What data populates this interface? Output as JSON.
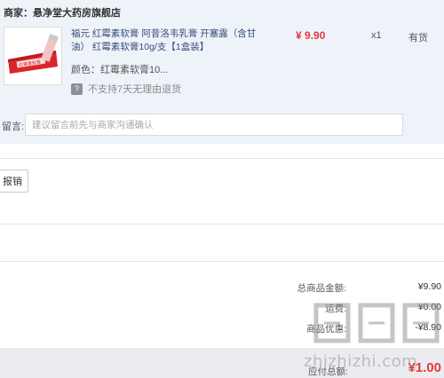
{
  "store": {
    "merchant_label": "商家：",
    "merchant_name": "悬净堂大药房旗舰店"
  },
  "product": {
    "title": "福元 红霉素软膏 阿昔洛韦乳膏 开塞露（含甘油） 红霉素软膏10g/支【1盒装】",
    "price": "¥ 9.90",
    "quantity": "x1",
    "stock": "有货",
    "color_label": "颜色：",
    "color_value": "红霉素软膏10...",
    "policy_text": "不支持7天无理由退货",
    "policy_icon": "question-icon",
    "package_text": "红霉素软膏"
  },
  "message": {
    "label": "留言:",
    "placeholder": "建议留言前先与商家沟通确认"
  },
  "reimburse": {
    "label": "报销"
  },
  "summary": {
    "goods_total_label": "总商品金额:",
    "goods_total_value": "¥9.90",
    "shipping_label": "运费:",
    "shipping_value": "¥0.00",
    "discount_label": "商品优惠:",
    "discount_value": "-¥8.90",
    "payable_label": "应付总额:",
    "payable_value": "¥1.00"
  },
  "watermark": {
    "text": "zhizhizhi.com"
  },
  "colors": {
    "price_red": "#e4393c",
    "panel_bg": "#eef3fa",
    "bottom_bar": "#eaecef"
  }
}
